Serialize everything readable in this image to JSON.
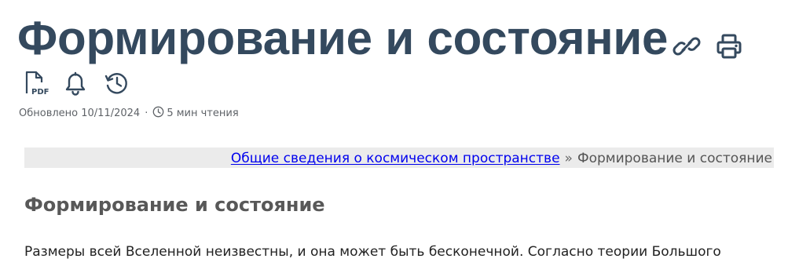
{
  "page": {
    "title": "Формирование и состояние",
    "updated_label": "Обновлено 10/11/2024",
    "separator": "·",
    "reading_time": "5 мин чтения"
  },
  "icons": {
    "copy_link": "link-icon",
    "print": "printer-icon",
    "pdf": "pdf-icon",
    "pdf_text": "PDF",
    "subscribe": "bell-icon",
    "history": "history-icon",
    "reading_time": "clock-icon"
  },
  "breadcrumb": {
    "parent": "Общие сведения о космическом пространстве",
    "separator": "»",
    "current": "Формирование и состояние"
  },
  "article": {
    "heading": "Формирование и состояние",
    "paragraph": "Размеры всей Вселенной неизвестны, и она может быть бесконечной. Согласно теории Большого"
  },
  "colors": {
    "title": "#34495e",
    "icon": "#34495e",
    "link": "#0000ee",
    "breadcrumb_bg": "#ebebeb",
    "heading": "#585858"
  }
}
